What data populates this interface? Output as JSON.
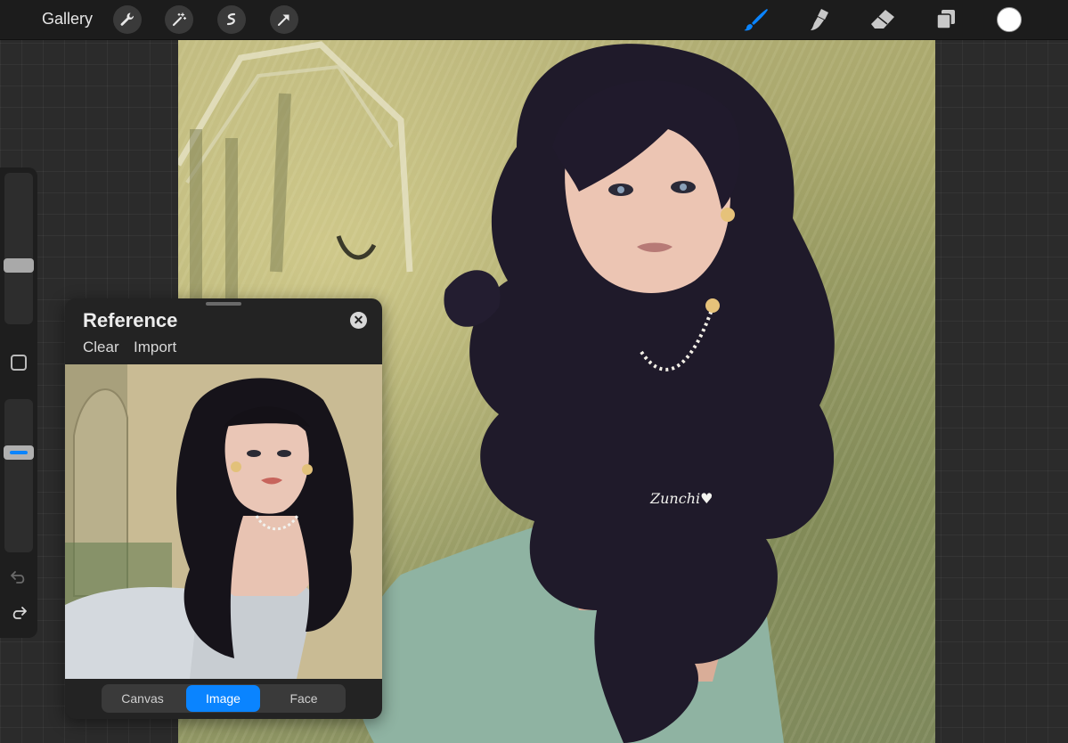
{
  "topbar": {
    "gallery_label": "Gallery",
    "left_tools": [
      "wrench-icon",
      "magic-wand-icon",
      "selection-icon",
      "arrow-transform-icon"
    ],
    "right_tools": [
      "brush-icon",
      "smudge-icon",
      "eraser-icon",
      "layers-icon"
    ],
    "active_tool": "brush-icon",
    "accent_color": "#0a84ff",
    "current_color": "#ffffff"
  },
  "sidebar": {
    "brush_size_level": 0.42,
    "opacity_level": 0.65,
    "controls": [
      "modify-button",
      "undo-icon",
      "redo-icon"
    ]
  },
  "canvas": {
    "signature": "Zunchi♥"
  },
  "reference": {
    "title": "Reference",
    "clear_label": "Clear",
    "import_label": "Import",
    "close_symbol": "✕",
    "tabs": [
      "Canvas",
      "Image",
      "Face"
    ],
    "selected_tab": "Image"
  }
}
